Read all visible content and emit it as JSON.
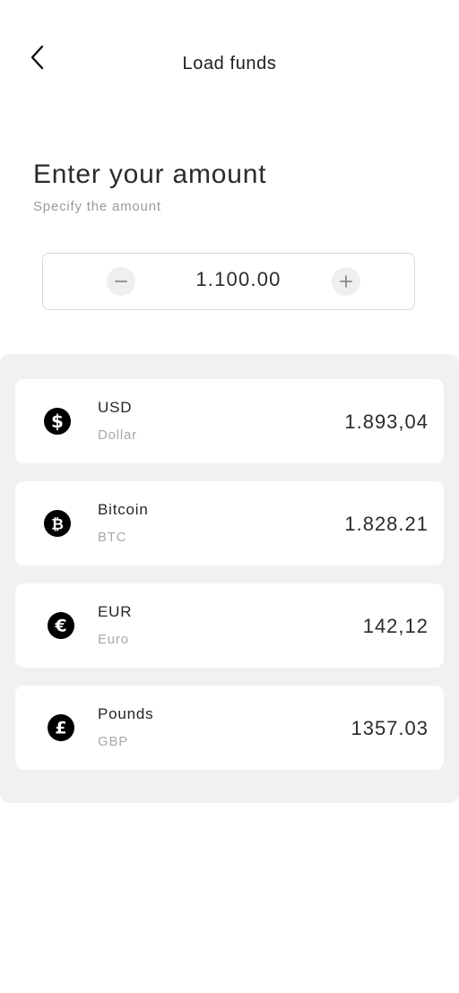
{
  "header": {
    "title": "Load funds",
    "back_icon": "chevron-left-icon"
  },
  "amount_section": {
    "heading": "Enter your amount",
    "subheading": "Specify the amount",
    "value": "1.100.00",
    "minus_icon": "minus-icon",
    "plus_icon": "plus-icon"
  },
  "currencies": [
    {
      "name": "USD",
      "code": "Dollar",
      "value": "1.893,04",
      "icon": "dollar-coin-icon"
    },
    {
      "name": "Bitcoin",
      "code": "BTC",
      "value": "1.828.21",
      "icon": "bitcoin-coin-icon"
    },
    {
      "name": "EUR",
      "code": "Euro",
      "value": "142,12",
      "icon": "euro-coin-icon"
    },
    {
      "name": "Pounds",
      "code": "GBP",
      "value": "1357.03",
      "icon": "pound-coin-icon"
    }
  ],
  "colors": {
    "panel_background": "#f1f1f1",
    "card_background": "#ffffff",
    "text_primary": "#2b2b2b",
    "text_muted": "#a8a8a8"
  }
}
